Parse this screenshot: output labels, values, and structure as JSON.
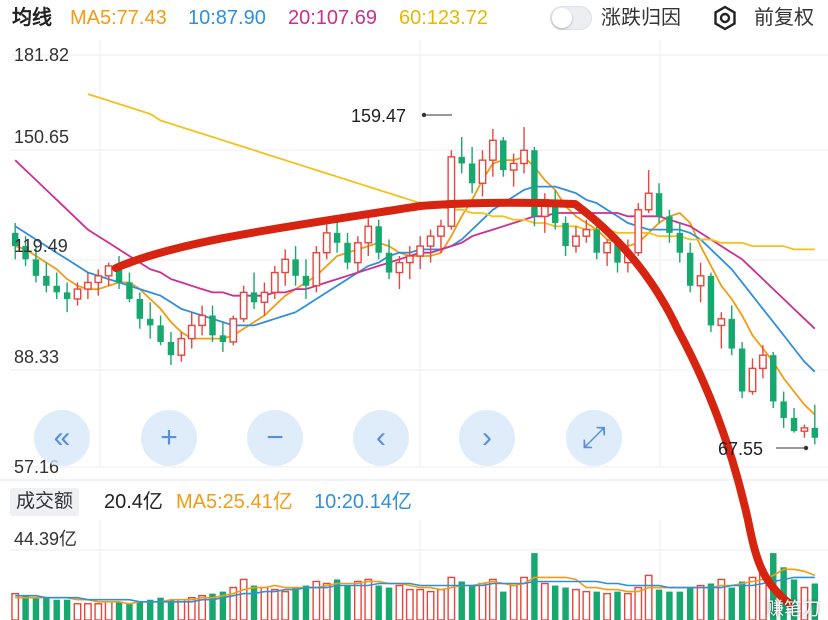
{
  "topbar": {
    "title": "均线",
    "ma5": "MA5:77.43",
    "ma10": "10:87.90",
    "ma20": "20:107.69",
    "ma60": "60:123.72",
    "toggle_label": "涨跌归因",
    "adjust_label": "前复权"
  },
  "colors": {
    "up": "#e8453c",
    "down": "#16a86f",
    "ma5": "#f39c12",
    "ma10": "#2f8fdc",
    "ma20": "#cc2e92",
    "ma60": "#f2c21b",
    "annotation": "#d72410"
  },
  "price_axis": {
    "labels": [
      "181.82",
      "150.65",
      "119.49",
      "88.33",
      "57.16"
    ]
  },
  "markers": {
    "high": "159.47",
    "low": "67.55"
  },
  "controls": [
    {
      "name": "scroll-left-fast-button",
      "label": "«"
    },
    {
      "name": "zoom-in-button",
      "label": "+"
    },
    {
      "name": "zoom-out-button",
      "label": "−"
    },
    {
      "name": "scroll-left-button",
      "label": "‹"
    },
    {
      "name": "scroll-right-button",
      "label": "›"
    },
    {
      "name": "fullscreen-button",
      "label": "⤢"
    }
  ],
  "volume": {
    "tab_label": "成交额",
    "value": "20.4亿",
    "ma5": "MA5:25.41亿",
    "ma10": "10:20.14亿",
    "axis_max": "44.39亿"
  },
  "watermark": "赚笔刀",
  "chart_data": {
    "type": "candlestick",
    "ylim": [
      57.16,
      181.82
    ],
    "candles": [
      [
        128,
        131,
        120,
        124
      ],
      [
        124,
        127,
        118,
        120
      ],
      [
        120,
        124,
        113,
        115
      ],
      [
        115,
        119,
        110,
        112
      ],
      [
        112,
        116,
        108,
        110
      ],
      [
        110,
        113,
        104,
        108
      ],
      [
        108,
        113,
        106,
        111
      ],
      [
        111,
        116,
        108,
        113
      ],
      [
        113,
        117,
        109,
        115
      ],
      [
        115,
        119,
        112,
        118
      ],
      [
        118,
        121,
        111,
        113
      ],
      [
        113,
        116,
        107,
        108
      ],
      [
        108,
        110,
        99,
        102
      ],
      [
        102,
        107,
        96,
        100
      ],
      [
        100,
        103,
        94,
        95
      ],
      [
        95,
        98,
        88,
        91
      ],
      [
        91,
        98,
        89,
        96
      ],
      [
        96,
        104,
        93,
        100
      ],
      [
        100,
        106,
        97,
        103
      ],
      [
        103,
        106,
        95,
        97
      ],
      [
        97,
        101,
        92,
        95
      ],
      [
        95,
        103,
        94,
        102
      ],
      [
        102,
        112,
        101,
        110
      ],
      [
        110,
        116,
        105,
        107
      ],
      [
        107,
        113,
        103,
        110
      ],
      [
        110,
        118,
        108,
        116
      ],
      [
        116,
        123,
        112,
        120
      ],
      [
        120,
        124,
        112,
        115
      ],
      [
        115,
        120,
        108,
        112
      ],
      [
        112,
        124,
        110,
        122
      ],
      [
        122,
        131,
        120,
        128
      ],
      [
        128,
        133,
        122,
        125
      ],
      [
        125,
        128,
        117,
        119
      ],
      [
        119,
        127,
        116,
        125
      ],
      [
        125,
        133,
        121,
        130
      ],
      [
        130,
        132,
        120,
        122
      ],
      [
        122,
        126,
        114,
        116
      ],
      [
        116,
        121,
        111,
        119
      ],
      [
        119,
        124,
        114,
        121
      ],
      [
        121,
        127,
        117,
        124
      ],
      [
        124,
        129,
        119,
        127
      ],
      [
        127,
        132,
        122,
        130
      ],
      [
        130,
        153,
        129,
        151
      ],
      [
        151,
        157,
        146,
        149
      ],
      [
        149,
        154,
        140,
        143
      ],
      [
        143,
        153,
        139,
        150
      ],
      [
        150,
        159.47,
        145,
        156
      ],
      [
        156,
        157,
        145,
        147
      ],
      [
        147,
        152,
        142,
        149
      ],
      [
        149,
        160,
        146,
        153
      ],
      [
        153,
        154,
        130,
        133
      ],
      [
        133,
        140,
        128,
        138
      ],
      [
        138,
        141,
        129,
        131
      ],
      [
        131,
        133,
        121,
        124
      ],
      [
        124,
        130,
        122,
        127
      ],
      [
        127,
        132,
        125,
        129
      ],
      [
        129,
        131,
        120,
        122
      ],
      [
        122,
        126,
        118,
        125
      ],
      [
        125,
        127,
        116,
        119
      ],
      [
        119,
        126,
        116,
        122
      ],
      [
        122,
        137,
        121,
        135
      ],
      [
        135,
        147,
        134,
        140
      ],
      [
        140,
        143,
        131,
        133
      ],
      [
        133,
        135,
        125,
        128
      ],
      [
        128,
        131,
        119,
        122
      ],
      [
        122,
        125,
        110,
        112
      ],
      [
        112,
        119,
        107,
        115
      ],
      [
        115,
        116,
        98,
        100
      ],
      [
        100,
        104,
        93,
        102
      ],
      [
        102,
        106,
        91,
        93
      ],
      [
        93,
        95,
        78,
        80
      ],
      [
        80,
        90,
        79,
        87
      ],
      [
        87,
        94,
        84,
        91
      ],
      [
        91,
        92,
        75,
        77
      ],
      [
        77,
        80,
        69,
        72
      ],
      [
        72,
        75,
        67.55,
        68
      ],
      [
        68,
        70,
        66,
        69
      ],
      [
        69,
        76,
        64,
        66
      ]
    ],
    "ma_series": [
      {
        "name": "MA5",
        "values": [
          124,
          123,
          121,
          119,
          117,
          114,
          112,
          111,
          111,
          112,
          113,
          113,
          111,
          108,
          105,
          101,
          98,
          96,
          96,
          96,
          96,
          97,
          99,
          101,
          103,
          106,
          109,
          111,
          113,
          115,
          118,
          121,
          122,
          123,
          124,
          125,
          124,
          122,
          121,
          121,
          121,
          122,
          127,
          133,
          138,
          144,
          149,
          150,
          150,
          151,
          148,
          144,
          141,
          136,
          133,
          131,
          129,
          126,
          125,
          124,
          125,
          128,
          131,
          133,
          134,
          131,
          124,
          118,
          112,
          108,
          103,
          97,
          93,
          89,
          84,
          80,
          76,
          73
        ]
      },
      {
        "name": "10",
        "values": [
          130,
          128,
          126,
          124,
          122,
          120,
          118,
          116,
          115,
          114,
          113,
          112,
          111,
          110,
          109,
          107,
          105,
          104,
          103,
          102,
          101,
          100,
          100,
          100,
          101,
          102,
          103,
          104,
          106,
          108,
          110,
          112,
          114,
          116,
          118,
          119,
          121,
          122,
          122,
          123,
          123,
          123,
          124,
          126,
          129,
          132,
          135,
          137,
          139,
          141,
          142,
          142,
          142,
          141,
          140,
          138,
          137,
          135,
          133,
          131,
          130,
          129,
          129,
          129,
          129,
          128,
          126,
          123,
          120,
          117,
          113,
          109,
          105,
          101,
          97,
          93,
          89,
          86
        ]
      },
      {
        "name": "20",
        "values": [
          150,
          147,
          144,
          141,
          138,
          135,
          132,
          129,
          127,
          125,
          123,
          121,
          119,
          117,
          116,
          114,
          113,
          112,
          111,
          110,
          110,
          109,
          109,
          109,
          109,
          110,
          110,
          111,
          111,
          112,
          113,
          114,
          115,
          116,
          117,
          118,
          119,
          120,
          121,
          122,
          122,
          123,
          124,
          125,
          127,
          128,
          129,
          130,
          131,
          132,
          133,
          133,
          134,
          134,
          134,
          134,
          134,
          134,
          134,
          133,
          133,
          133,
          133,
          132,
          131,
          130,
          128,
          126,
          124,
          122,
          120,
          117,
          114,
          111,
          108,
          105,
          102,
          99
        ]
      },
      {
        "name": "60",
        "values": [
          171,
          172,
          172,
          172,
          172,
          171,
          171,
          170,
          169,
          168,
          167,
          166,
          165,
          164,
          162,
          161,
          160,
          159,
          158,
          157,
          156,
          155,
          154,
          153,
          152,
          151,
          150,
          149,
          148,
          147,
          146,
          145,
          144,
          143,
          142,
          141,
          140,
          139,
          138,
          137,
          137,
          136,
          135,
          135,
          134,
          134,
          133,
          133,
          132,
          132,
          131,
          131,
          130,
          130,
          130,
          129,
          129,
          129,
          128,
          128,
          128,
          128,
          127,
          127,
          127,
          126,
          126,
          126,
          125,
          125,
          125,
          124,
          124,
          124,
          124,
          123,
          123,
          123
        ]
      }
    ],
    "volume": [
      13,
      12,
      11,
      11,
      10,
      10,
      8,
      8,
      8,
      9,
      9,
      8,
      9,
      10,
      11,
      10,
      10,
      11,
      12,
      13,
      14,
      16,
      20,
      17,
      16,
      15,
      14,
      16,
      17,
      19,
      18,
      20,
      17,
      19,
      20,
      17,
      16,
      17,
      15,
      15,
      14,
      15,
      21,
      19,
      17,
      18,
      20,
      14,
      17,
      21,
      33,
      18,
      17,
      16,
      15,
      14,
      14,
      13,
      14,
      13,
      16,
      22,
      15,
      14,
      14,
      16,
      17,
      18,
      20,
      16,
      19,
      21,
      24,
      33,
      26,
      20,
      16,
      18
    ],
    "volume_up": [
      true,
      false,
      false,
      false,
      false,
      false,
      true,
      true,
      true,
      true,
      false,
      false,
      false,
      false,
      false,
      false,
      true,
      true,
      true,
      false,
      false,
      true,
      true,
      false,
      true,
      true,
      true,
      false,
      false,
      true,
      true,
      false,
      false,
      true,
      true,
      false,
      false,
      true,
      true,
      true,
      true,
      true,
      true,
      false,
      false,
      true,
      true,
      false,
      true,
      true,
      false,
      true,
      false,
      false,
      true,
      true,
      false,
      true,
      false,
      true,
      true,
      true,
      false,
      false,
      false,
      false,
      true,
      false,
      true,
      false,
      false,
      true,
      true,
      false,
      false,
      false,
      true,
      false
    ],
    "volume_ma5": [
      11,
      11,
      11,
      11,
      11,
      11,
      10,
      10,
      9,
      9,
      9,
      8,
      9,
      9,
      9,
      10,
      10,
      10,
      11,
      11,
      12,
      13,
      15,
      16,
      16,
      17,
      16,
      16,
      16,
      16,
      17,
      18,
      18,
      18,
      19,
      19,
      18,
      18,
      17,
      16,
      16,
      15,
      16,
      17,
      17,
      18,
      19,
      18,
      17,
      18,
      21,
      21,
      21,
      21,
      20,
      16,
      16,
      15,
      15,
      14,
      14,
      16,
      16,
      16,
      16,
      16,
      16,
      16,
      17,
      17,
      18,
      19,
      20,
      22,
      25,
      25,
      24,
      22
    ],
    "volume_ma10": [
      12,
      12,
      12,
      11,
      11,
      11,
      11,
      10,
      10,
      10,
      10,
      10,
      9,
      9,
      9,
      9,
      9,
      9,
      10,
      10,
      11,
      12,
      13,
      13,
      14,
      14,
      15,
      15,
      16,
      16,
      16,
      17,
      17,
      17,
      17,
      18,
      18,
      18,
      18,
      17,
      17,
      17,
      17,
      17,
      17,
      17,
      18,
      18,
      18,
      18,
      19,
      19,
      19,
      19,
      19,
      19,
      19,
      18,
      18,
      17,
      17,
      17,
      17,
      16,
      16,
      16,
      16,
      16,
      16,
      17,
      17,
      17,
      18,
      19,
      20,
      21,
      21,
      21
    ],
    "volume_max": 44.39
  }
}
